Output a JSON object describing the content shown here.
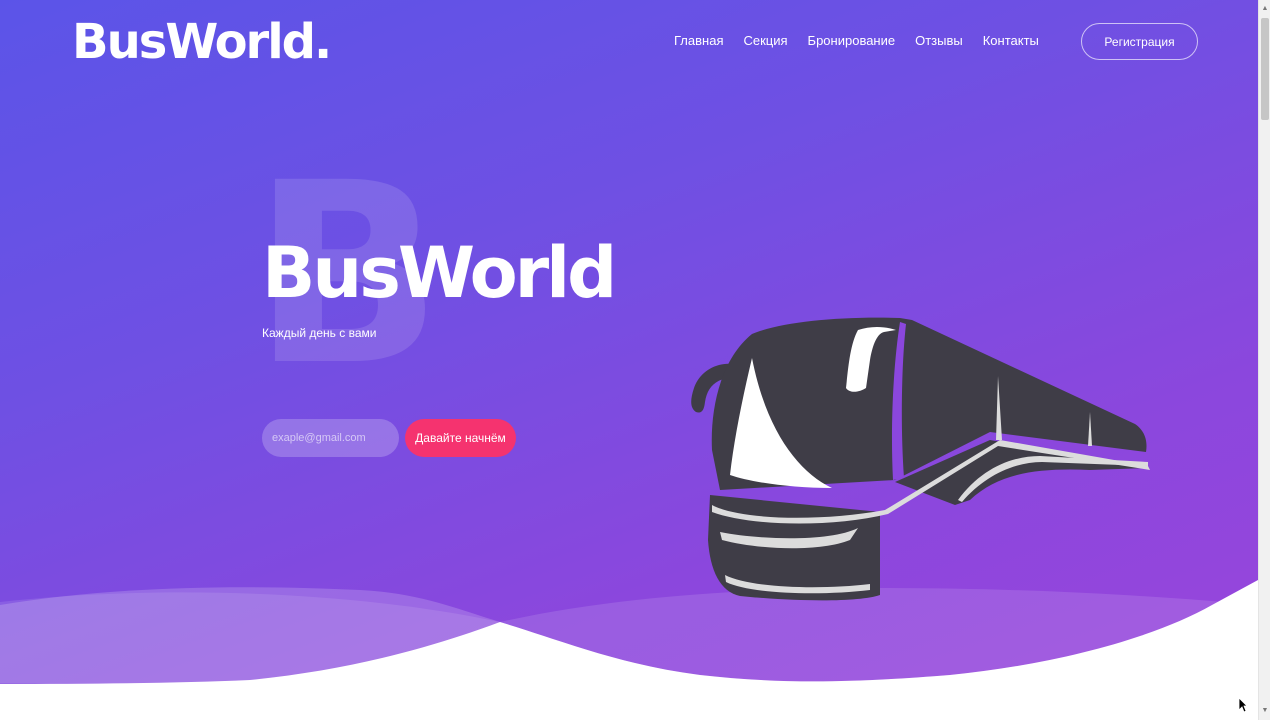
{
  "header": {
    "logo": "BusWorld.",
    "nav": [
      {
        "label": "Главная"
      },
      {
        "label": "Секция"
      },
      {
        "label": "Бронирование"
      },
      {
        "label": "Отзывы"
      },
      {
        "label": "Контакты"
      }
    ],
    "register_label": "Регистрация"
  },
  "hero": {
    "bg_letter": "B",
    "title": "BusWorld",
    "subtitle": "Каждый день с вами",
    "email_placeholder": "exaple@gmail.com",
    "start_label": "Давайте начнём"
  },
  "colors": {
    "gradient_start": "#5b54e8",
    "gradient_end": "#9a45dc",
    "accent": "#f5336f",
    "bus_body": "#3f3d47"
  },
  "icons": {
    "bus": "bus-icon",
    "cursor": "mouse-pointer-icon"
  }
}
